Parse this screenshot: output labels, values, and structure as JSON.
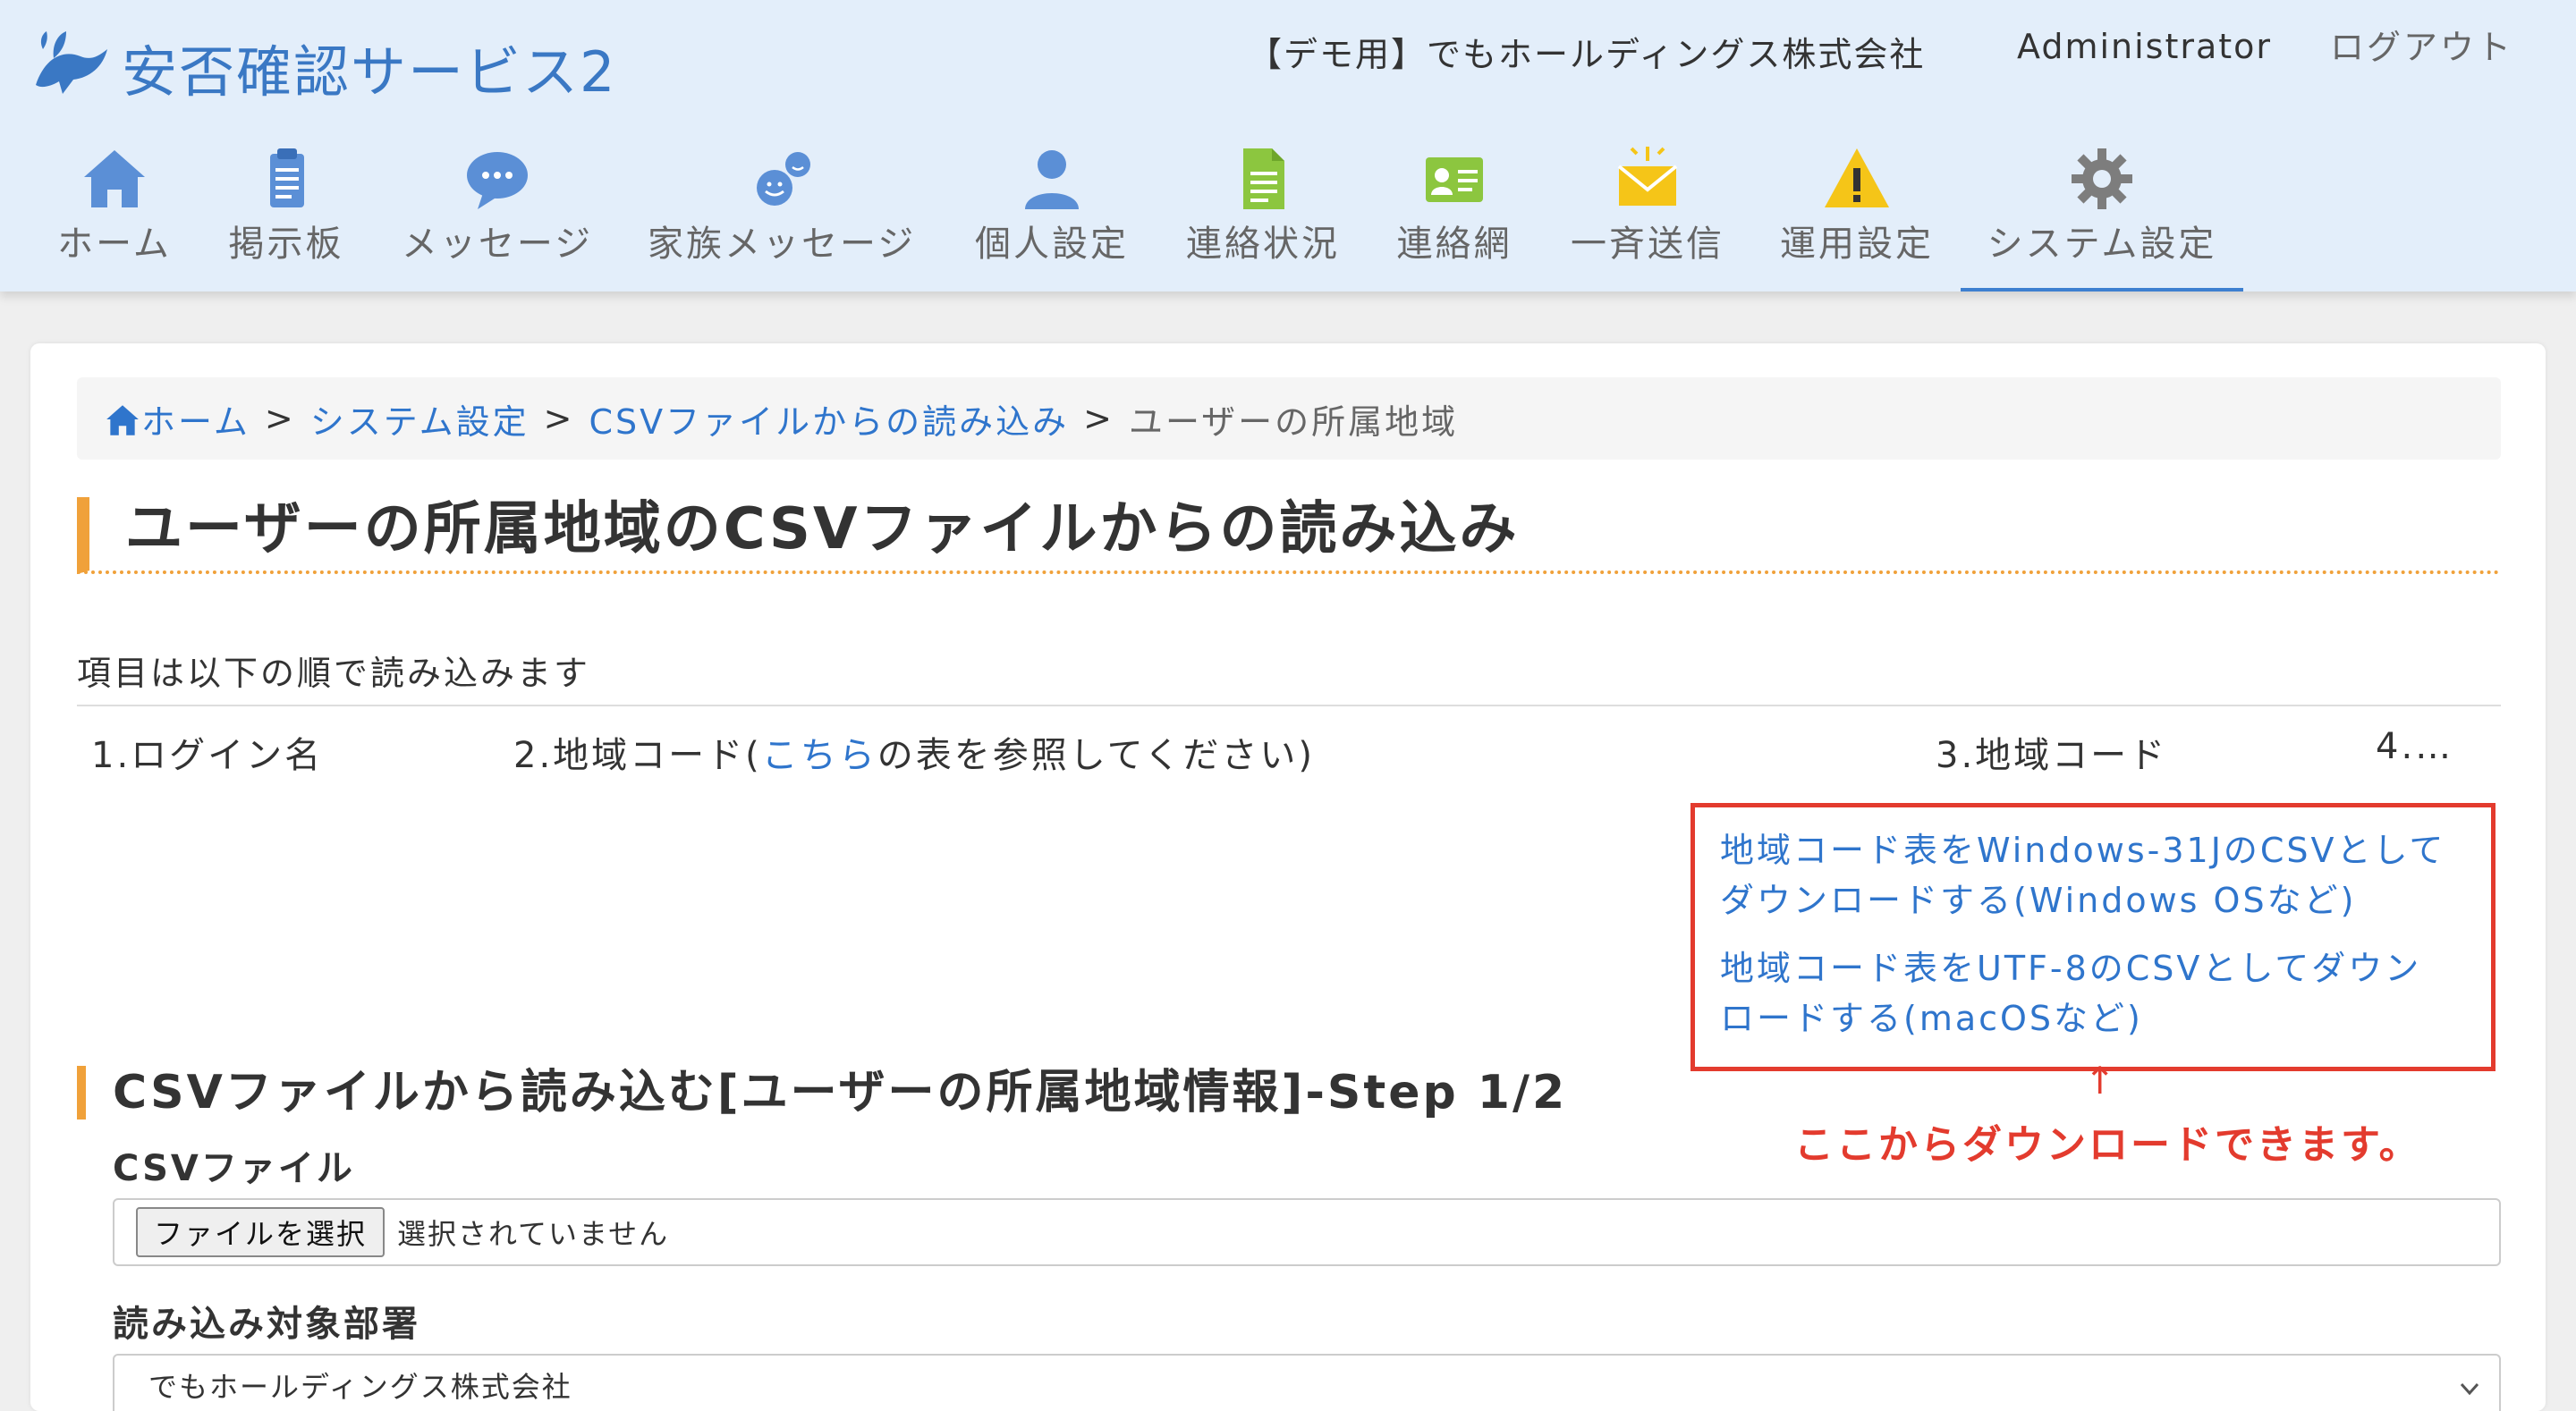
{
  "app": {
    "logo_text": "安否確認サービス2",
    "company": "【デモ用】でもホールディングス株式会社",
    "user": "Administrator",
    "logout": "ログアウト"
  },
  "nav": [
    {
      "label": "ホーム",
      "icon": "home-icon"
    },
    {
      "label": "掲示板",
      "icon": "clipboard-icon"
    },
    {
      "label": "メッセージ",
      "icon": "speech-bubble-icon"
    },
    {
      "label": "家族メッセージ",
      "icon": "family-faces-icon"
    },
    {
      "label": "個人設定",
      "icon": "person-icon"
    },
    {
      "label": "連絡状況",
      "icon": "document-icon"
    },
    {
      "label": "連絡網",
      "icon": "contact-card-icon"
    },
    {
      "label": "一斉送信",
      "icon": "envelope-icon"
    },
    {
      "label": "運用設定",
      "icon": "warning-icon"
    },
    {
      "label": "システム設定",
      "icon": "gear-icon",
      "active": true
    }
  ],
  "breadcrumb": {
    "home": "ホーム",
    "system": "システム設定",
    "csv": "CSVファイルからの読み込み",
    "current": "ユーザーの所属地域",
    "separator": ">"
  },
  "page_title": "ユーザーの所属地域のCSVファイルからの読み込み",
  "intro": "項目は以下の順で読み込みます",
  "items": {
    "item1": "1.ログイン名",
    "item2_prefix": "2.地域コード(",
    "item2_link": "こちら",
    "item2_suffix": "の表を参照してください)",
    "item3": "3.地域コード",
    "item4": "4.…"
  },
  "downloads": {
    "win_line1": "地域コード表をWindows-31JのCSVとして",
    "win_line2": "ダウンロードする(Windows OSなど)",
    "utf_line1": "地域コード表をUTF-8のCSVとしてダウン",
    "utf_line2": "ロードする(macOSなど)"
  },
  "annotation": {
    "arrow": "↑",
    "note": "ここからダウンロードできます。"
  },
  "form": {
    "section_title": "CSVファイルから読み込む[ユーザーの所属地域情報]-Step 1/2",
    "csv_label": "CSVファイル",
    "file_button": "ファイルを選択",
    "file_status": "選択されていません",
    "dept_label": "読み込み対象部署",
    "dept_value": "でもホールディングス株式会社"
  },
  "colors": {
    "header_bg": "#e3eefa",
    "link": "#2f75cc",
    "accent": "#f0a13a",
    "highlight_red": "#e33b2e"
  }
}
